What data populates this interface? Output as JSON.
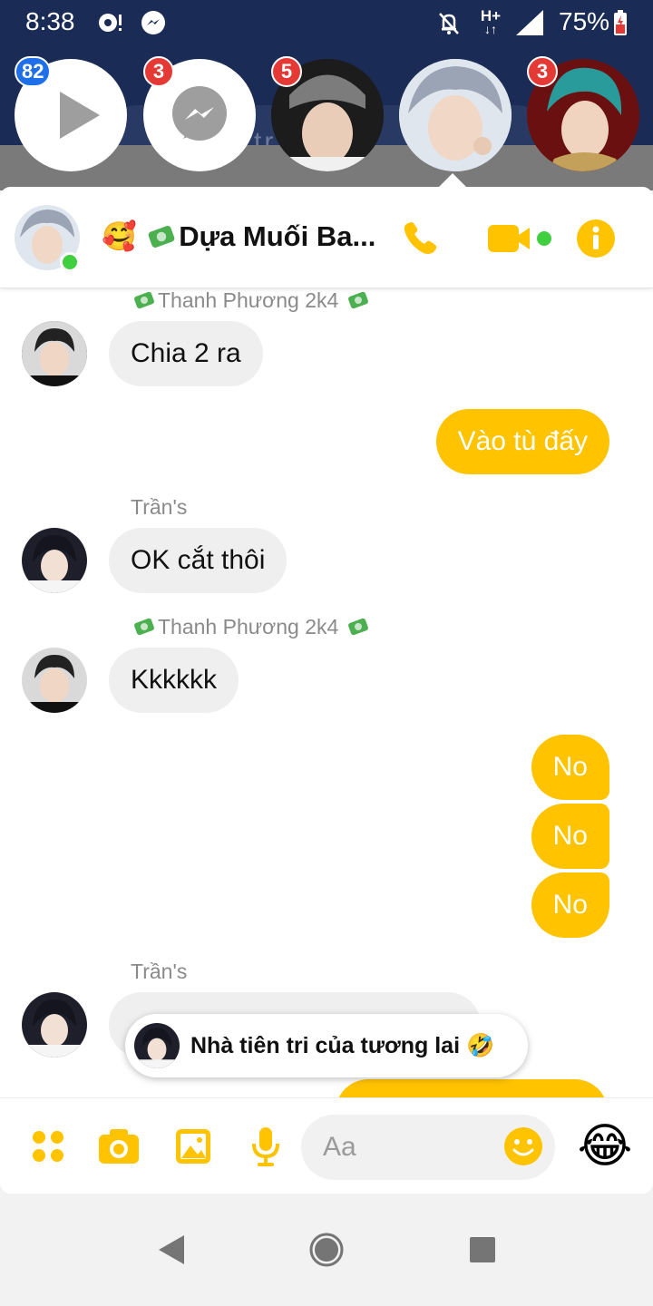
{
  "status_bar": {
    "time": "8:38",
    "battery": "75%",
    "network": "H+"
  },
  "background": {
    "search_fragment": "tr  vr"
  },
  "chat_heads": [
    {
      "name": "video-head",
      "badge": "82",
      "badge_color": "#1e6fe8"
    },
    {
      "name": "messenger-head",
      "badge": "3",
      "badge_color": "#e53935"
    },
    {
      "name": "contact-head-1",
      "badge": "5",
      "badge_color": "#e53935"
    },
    {
      "name": "contact-head-2",
      "badge": "",
      "badge_color": ""
    },
    {
      "name": "contact-head-3",
      "badge": "3",
      "badge_color": "#e53935"
    }
  ],
  "chat": {
    "title_emoji": "🥰",
    "title": "Dựa Muối Ba...",
    "accent_color": "#ffc300",
    "messages": [
      {
        "direction": "in",
        "sender": "Thanh Phương 2k4",
        "text": "Chia 2 ra"
      },
      {
        "direction": "out",
        "text": "Vào tù đấy"
      },
      {
        "direction": "in",
        "sender": "Trần's",
        "text": "OK cắt thôi"
      },
      {
        "direction": "in",
        "sender": "Thanh Phương 2k4",
        "text": "Kkkkkk"
      },
      {
        "direction": "out",
        "text": "No"
      },
      {
        "direction": "out",
        "text": "No"
      },
      {
        "direction": "out",
        "text": "No"
      },
      {
        "direction": "in",
        "sender": "Trần's",
        "text": ""
      }
    ]
  },
  "toast": {
    "text": "Nhà tiên tri của tương lai",
    "emoji": "🤣"
  },
  "composer": {
    "placeholder": "Aa",
    "quick_reaction": "😂"
  }
}
